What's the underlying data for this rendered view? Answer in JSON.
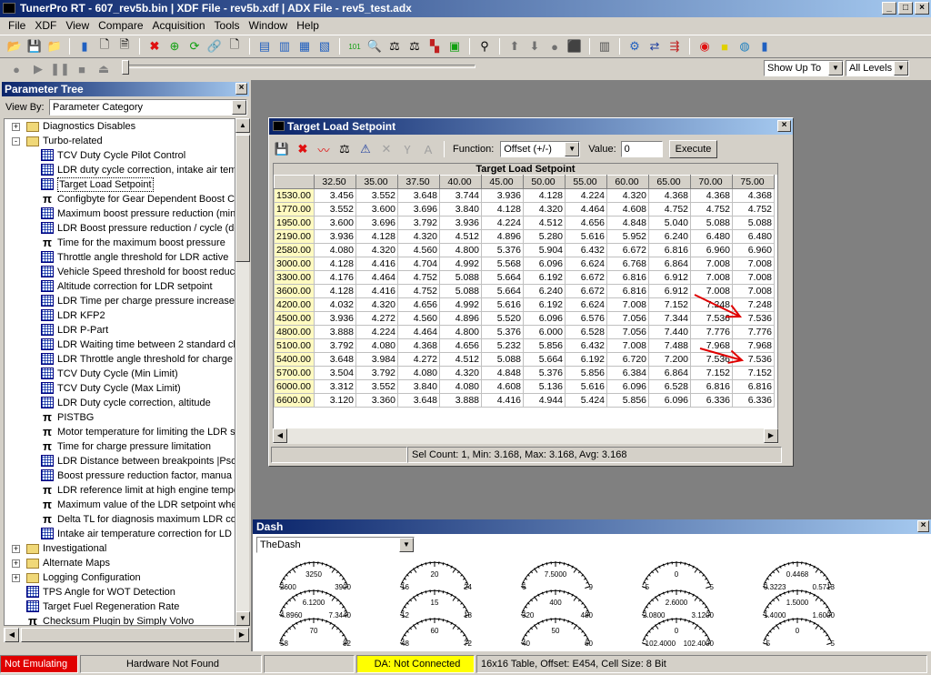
{
  "app": {
    "title": "TunerPro RT - 607_rev5b.bin | XDF File - rev5b.xdf | ADX File - rev5_test.adx",
    "window_buttons": [
      "_",
      "□",
      "×"
    ]
  },
  "menu": [
    "File",
    "XDF",
    "View",
    "Compare",
    "Acquisition",
    "Tools",
    "Window",
    "Help"
  ],
  "toolbar_right": {
    "filter_value": "Show Up To",
    "level_value": "All Levels"
  },
  "param_tree": {
    "title": "Parameter Tree",
    "view_by_label": "View By:",
    "view_by_value": "Parameter Category",
    "items": [
      {
        "kind": "folder",
        "exp": "+",
        "depth": 0,
        "label": "Diagnostics Disables"
      },
      {
        "kind": "folder",
        "exp": "-",
        "depth": 0,
        "label": "Turbo-related"
      },
      {
        "kind": "grid",
        "depth": 1,
        "label": "TCV Duty Cycle Pilot Control"
      },
      {
        "kind": "grid",
        "depth": 1,
        "label": "LDR duty cycle correction, intake air tem"
      },
      {
        "kind": "grid",
        "depth": 1,
        "label": "Target Load Setpoint",
        "selected": true
      },
      {
        "kind": "pi",
        "depth": 1,
        "label": "Configbyte for Gear Dependent Boost C"
      },
      {
        "kind": "grid",
        "depth": 1,
        "label": "Maximum boost pressure reduction (min"
      },
      {
        "kind": "grid",
        "depth": 1,
        "label": "LDR Boost pressure reduction / cycle (de"
      },
      {
        "kind": "pi",
        "depth": 1,
        "label": "Time for the maximum boost pressure"
      },
      {
        "kind": "grid",
        "depth": 1,
        "label": "Throttle angle threshold for LDR active"
      },
      {
        "kind": "grid",
        "depth": 1,
        "label": "Vehicle Speed threshold for boost reduc"
      },
      {
        "kind": "grid",
        "depth": 1,
        "label": "Altitude correction for LDR setpoint"
      },
      {
        "kind": "grid",
        "depth": 1,
        "label": "LDR Time per charge pressure increase l"
      },
      {
        "kind": "grid",
        "depth": 1,
        "label": "LDR KFP2"
      },
      {
        "kind": "grid",
        "depth": 1,
        "label": "LDR P-Part"
      },
      {
        "kind": "grid",
        "depth": 1,
        "label": "LDR Waiting time between 2 standard ch"
      },
      {
        "kind": "grid",
        "depth": 1,
        "label": "LDR Throttle angle threshold for charge"
      },
      {
        "kind": "grid",
        "depth": 1,
        "label": "TCV Duty Cycle (Min Limit)"
      },
      {
        "kind": "grid",
        "depth": 1,
        "label": "TCV Duty Cycle (Max Limit)"
      },
      {
        "kind": "grid",
        "depth": 1,
        "label": "LDR Duty cycle correction, altitude"
      },
      {
        "kind": "pi",
        "depth": 1,
        "label": "PISTBG"
      },
      {
        "kind": "pi",
        "depth": 1,
        "label": "Motor temperature for limiting the LDR s"
      },
      {
        "kind": "pi",
        "depth": 1,
        "label": "Time for charge pressure limitation"
      },
      {
        "kind": "grid",
        "depth": 1,
        "label": "LDR Distance between breakpoints |Pso"
      },
      {
        "kind": "grid",
        "depth": 1,
        "label": "Boost pressure reduction factor, manua"
      },
      {
        "kind": "pi",
        "depth": 1,
        "label": "LDR reference limit at high engine tempe"
      },
      {
        "kind": "pi",
        "depth": 1,
        "label": "Maximum value of the LDR setpoint whe"
      },
      {
        "kind": "pi",
        "depth": 1,
        "label": "Delta TL for diagnosis maximum LDR con"
      },
      {
        "kind": "grid",
        "depth": 1,
        "label": "Intake air temperature correction for LD"
      },
      {
        "kind": "folder",
        "exp": "+",
        "depth": 0,
        "label": "Investigational"
      },
      {
        "kind": "folder",
        "exp": "+",
        "depth": 0,
        "label": "Alternate Maps"
      },
      {
        "kind": "folder",
        "exp": "+",
        "depth": 0,
        "label": "Logging Configuration"
      },
      {
        "kind": "grid",
        "depth": 0,
        "label": "TPS Angle for WOT Detection"
      },
      {
        "kind": "grid",
        "depth": 0,
        "label": "Target Fuel Regeneration Rate"
      },
      {
        "kind": "pi",
        "depth": 0,
        "label": "Checksum Plugin by Simply Volvo"
      }
    ]
  },
  "table_window": {
    "title": "Target Load Setpoint",
    "function_label": "Function:",
    "function_value": "Offset (+/-)",
    "value_label": "Value:",
    "value_input": "0",
    "execute_label": "Execute",
    "table_title": "Target Load Setpoint",
    "columns": [
      "32.50",
      "35.00",
      "37.50",
      "40.00",
      "45.00",
      "50.00",
      "55.00",
      "60.00",
      "65.00",
      "70.00",
      "75.00"
    ],
    "rows": [
      {
        "h": "1530.00",
        "v": [
          "3.456",
          "3.552",
          "3.648",
          "3.744",
          "3.936",
          "4.128",
          "4.224",
          "4.320",
          "4.368",
          "4.368",
          "4.368"
        ]
      },
      {
        "h": "1770.00",
        "v": [
          "3.552",
          "3.600",
          "3.696",
          "3.840",
          "4.128",
          "4.320",
          "4.464",
          "4.608",
          "4.752",
          "4.752",
          "4.752"
        ]
      },
      {
        "h": "1950.00",
        "v": [
          "3.600",
          "3.696",
          "3.792",
          "3.936",
          "4.224",
          "4.512",
          "4.656",
          "4.848",
          "5.040",
          "5.088",
          "5.088"
        ]
      },
      {
        "h": "2190.00",
        "v": [
          "3.936",
          "4.128",
          "4.320",
          "4.512",
          "4.896",
          "5.280",
          "5.616",
          "5.952",
          "6.240",
          "6.480",
          "6.480"
        ]
      },
      {
        "h": "2580.00",
        "v": [
          "4.080",
          "4.320",
          "4.560",
          "4.800",
          "5.376",
          "5.904",
          "6.432",
          "6.672",
          "6.816",
          "6.960",
          "6.960"
        ]
      },
      {
        "h": "3000.00",
        "v": [
          "4.128",
          "4.416",
          "4.704",
          "4.992",
          "5.568",
          "6.096",
          "6.624",
          "6.768",
          "6.864",
          "7.008",
          "7.008"
        ]
      },
      {
        "h": "3300.00",
        "v": [
          "4.176",
          "4.464",
          "4.752",
          "5.088",
          "5.664",
          "6.192",
          "6.672",
          "6.816",
          "6.912",
          "7.008",
          "7.008"
        ]
      },
      {
        "h": "3600.00",
        "v": [
          "4.128",
          "4.416",
          "4.752",
          "5.088",
          "5.664",
          "6.240",
          "6.672",
          "6.816",
          "6.912",
          "7.008",
          "7.008"
        ]
      },
      {
        "h": "4200.00",
        "v": [
          "4.032",
          "4.320",
          "4.656",
          "4.992",
          "5.616",
          "6.192",
          "6.624",
          "7.008",
          "7.152",
          "7.248",
          "7.248"
        ]
      },
      {
        "h": "4500.00",
        "v": [
          "3.936",
          "4.272",
          "4.560",
          "4.896",
          "5.520",
          "6.096",
          "6.576",
          "7.056",
          "7.344",
          "7.536",
          "7.536"
        ]
      },
      {
        "h": "4800.00",
        "v": [
          "3.888",
          "4.224",
          "4.464",
          "4.800",
          "5.376",
          "6.000",
          "6.528",
          "7.056",
          "7.440",
          "7.776",
          "7.776"
        ]
      },
      {
        "h": "5100.00",
        "v": [
          "3.792",
          "4.080",
          "4.368",
          "4.656",
          "5.232",
          "5.856",
          "6.432",
          "7.008",
          "7.488",
          "7.968",
          "7.968"
        ]
      },
      {
        "h": "5400.00",
        "v": [
          "3.648",
          "3.984",
          "4.272",
          "4.512",
          "5.088",
          "5.664",
          "6.192",
          "6.720",
          "7.200",
          "7.536",
          "7.536"
        ]
      },
      {
        "h": "5700.00",
        "v": [
          "3.504",
          "3.792",
          "4.080",
          "4.320",
          "4.848",
          "5.376",
          "5.856",
          "6.384",
          "6.864",
          "7.152",
          "7.152"
        ]
      },
      {
        "h": "6000.00",
        "v": [
          "3.312",
          "3.552",
          "3.840",
          "4.080",
          "4.608",
          "5.136",
          "5.616",
          "6.096",
          "6.528",
          "6.816",
          "6.816"
        ]
      },
      {
        "h": "6600.00",
        "v": [
          "3.120",
          "3.360",
          "3.648",
          "3.888",
          "4.416",
          "4.944",
          "5.424",
          "5.856",
          "6.096",
          "6.336",
          "6.336"
        ]
      }
    ],
    "status": "Sel Count: 1, Min: 3.168, Max: 3.168, Avg: 3.168",
    "arrow_color": "#e00000"
  },
  "dash": {
    "title": "Dash",
    "select_value": "TheDash",
    "gauges": [
      {
        "value": "3250",
        "min": "2600",
        "max": "3900"
      },
      {
        "value": "20",
        "min": "16",
        "max": "24"
      },
      {
        "value": "7.5000",
        "min": "6",
        "max": "9"
      },
      {
        "value": "0",
        "min": "-5",
        "max": "5"
      },
      {
        "value": "0.4468",
        "min": "0.3223",
        "max": "0.5713"
      },
      {
        "value": "6.1200",
        "min": "4.8960",
        "max": "7.3440"
      },
      {
        "value": "15",
        "min": "12",
        "max": "18"
      },
      {
        "value": "400",
        "min": "320",
        "max": "480"
      },
      {
        "value": "2.6000",
        "min": "2.0800",
        "max": "3.1200"
      },
      {
        "value": "1.5000",
        "min": "1.4000",
        "max": "1.6000"
      },
      {
        "value": "70",
        "min": "58",
        "max": "82"
      },
      {
        "value": "60",
        "min": "48",
        "max": "72"
      },
      {
        "value": "50",
        "min": "40",
        "max": "60"
      },
      {
        "value": "0",
        "min": "-102.4000",
        "max": "102.4000"
      },
      {
        "value": "0",
        "min": "-5",
        "max": "5"
      }
    ]
  },
  "statusbar": {
    "emulating": "Not Emulating",
    "hardware": "Hardware Not Found",
    "da": "DA: Not Connected",
    "table_info": "16x16 Table, Offset: E454,  Cell Size: 8 Bit"
  },
  "colors": {
    "title_gradient_start": "#0a246a",
    "title_gradient_end": "#a6caf0",
    "not_emulating_bg": "#e00000",
    "da_bg": "#ffff00",
    "row_header_bg": "#fffac0"
  }
}
